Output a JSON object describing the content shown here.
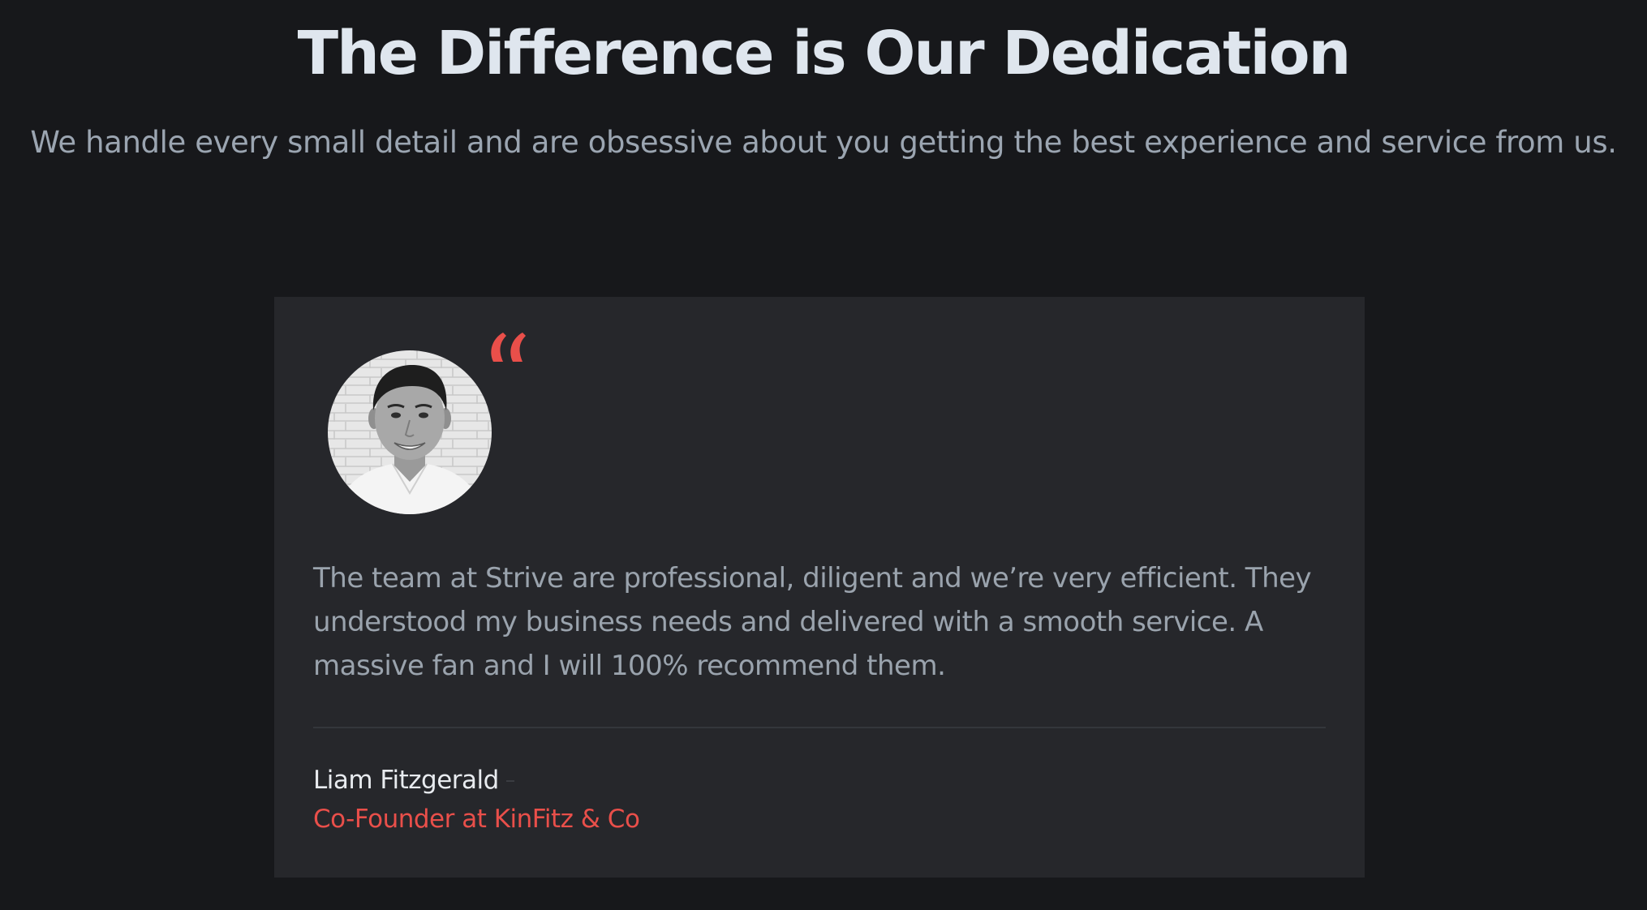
{
  "section": {
    "heading": "The Difference is Our Dedication",
    "subheading": "We handle every small detail and are obsessive about you getting the best experience and service from us."
  },
  "testimonial": {
    "quote_icon": "quote-mark-icon",
    "avatar_alt": "Liam Fitzgerald",
    "quote": "The team at Strive are professional, diligent and we’re very efficient. They understood my business needs and delivered with a smooth service. A massive fan and I will 100% recommend them.",
    "author_name": "Liam Fitzgerald",
    "author_role": "Co-Founder at KinFitz & Co"
  },
  "colors": {
    "background": "#17181b",
    "card": "#26272b",
    "heading": "#dfe6ee",
    "body_text": "#9aa3ad",
    "accent": "#e94f4a"
  }
}
